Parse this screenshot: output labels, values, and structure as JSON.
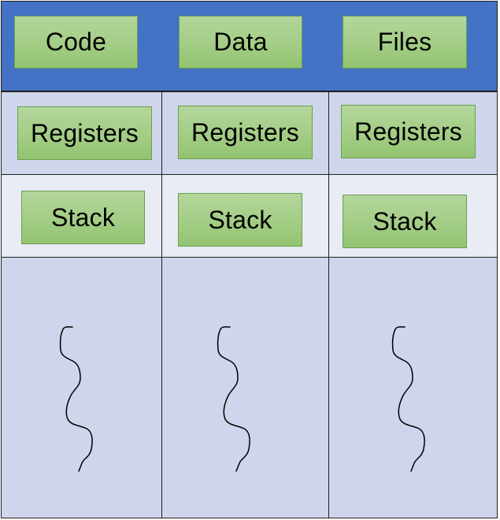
{
  "shared": {
    "code_label": "Code",
    "data_label": "Data",
    "files_label": "Files"
  },
  "threads": [
    {
      "registers_label": "Registers",
      "stack_label": "Stack"
    },
    {
      "registers_label": "Registers",
      "stack_label": "Stack"
    },
    {
      "registers_label": "Registers",
      "stack_label": "Stack"
    }
  ],
  "colors": {
    "shared_band": "#4472c4",
    "row_dark": "#cfd5ea",
    "row_light": "#e9ebf5",
    "box_fill": "#a3cd85",
    "box_border": "#6aa04d"
  },
  "icons": [
    "thread-squiggle-icon",
    "thread-squiggle-icon",
    "thread-squiggle-icon"
  ]
}
